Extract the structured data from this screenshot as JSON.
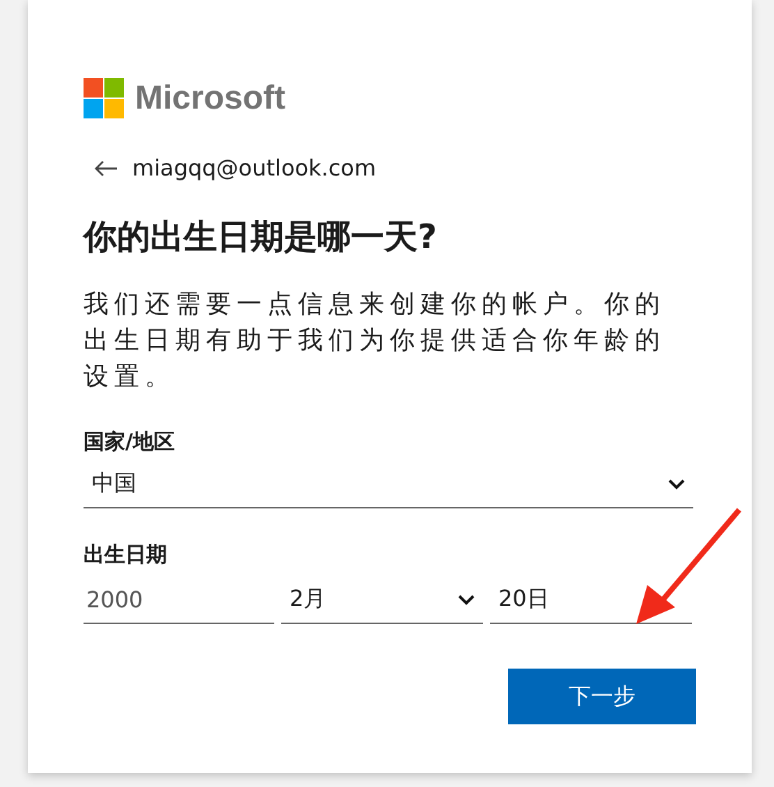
{
  "brand": {
    "name": "Microsoft"
  },
  "account": {
    "email": "miagqq@outlook.com"
  },
  "title": "你的出生日期是哪一天?",
  "description": "我们还需要一点信息来创建你的帐户。你的出生日期有助于我们为你提供适合你年龄的设置。",
  "country": {
    "label": "国家/地区",
    "value": "中国"
  },
  "birthdate": {
    "label": "出生日期",
    "year": "2000",
    "month": "2月",
    "day": "20日"
  },
  "buttons": [
    {
      "label": "下一步",
      "kind": "primary"
    }
  ]
}
